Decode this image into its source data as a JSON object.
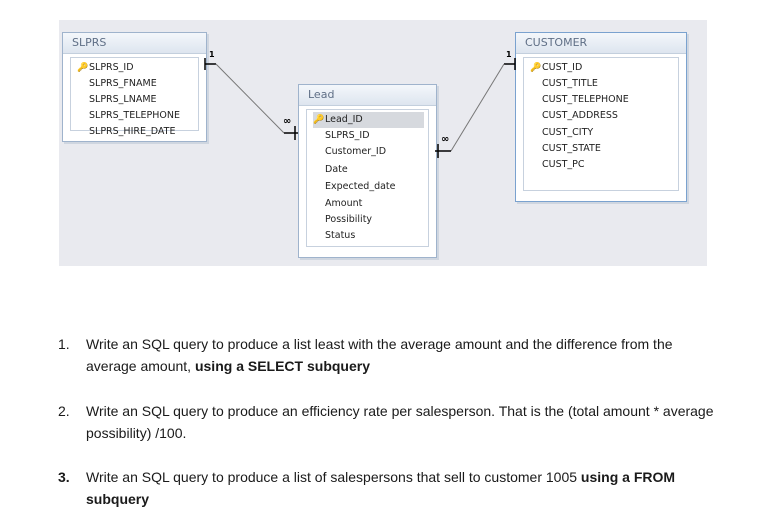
{
  "tables": {
    "slprs": {
      "title": "SLPRS",
      "fields": [
        "SLPRS_ID",
        "SLPRS_FNAME",
        "SLPRS_LNAME",
        "SLPRS_TELEPHONE",
        "SLPRS_HIRE_DATE"
      ],
      "key_field": "SLPRS_ID"
    },
    "lead": {
      "title": "Lead",
      "fields": [
        "Lead_ID",
        "SLPRS_ID",
        "Customer_ID",
        "Date",
        "Expected_date",
        "Amount",
        "Possibility",
        "Status"
      ],
      "key_field": "Lead_ID"
    },
    "customer": {
      "title": "CUSTOMER",
      "fields": [
        "CUST_ID",
        "CUST_TITLE",
        "CUST_TELEPHONE",
        "CUST_ADDRESS",
        "CUST_CITY",
        "CUST_STATE",
        "CUST_PC"
      ],
      "key_field": "CUST_ID"
    }
  },
  "relationships": {
    "one_label": "1",
    "many_label": "∞"
  },
  "questions": [
    {
      "num": "1.",
      "text": "Write an SQL query to produce a list least with the average amount and the difference from the average amount, ",
      "bold": "using a SELECT subquery",
      "tail": ""
    },
    {
      "num": "2.",
      "text": "Write an SQL query to produce an efficiency rate per salesperson. That is the (total amount * average possibility) /100.",
      "bold": "",
      "tail": ""
    },
    {
      "num": "3.",
      "text": "Write an SQL query to produce a list of salespersons that sell to customer 1005 ",
      "bold": "using a FROM subquery",
      "tail": ""
    }
  ]
}
